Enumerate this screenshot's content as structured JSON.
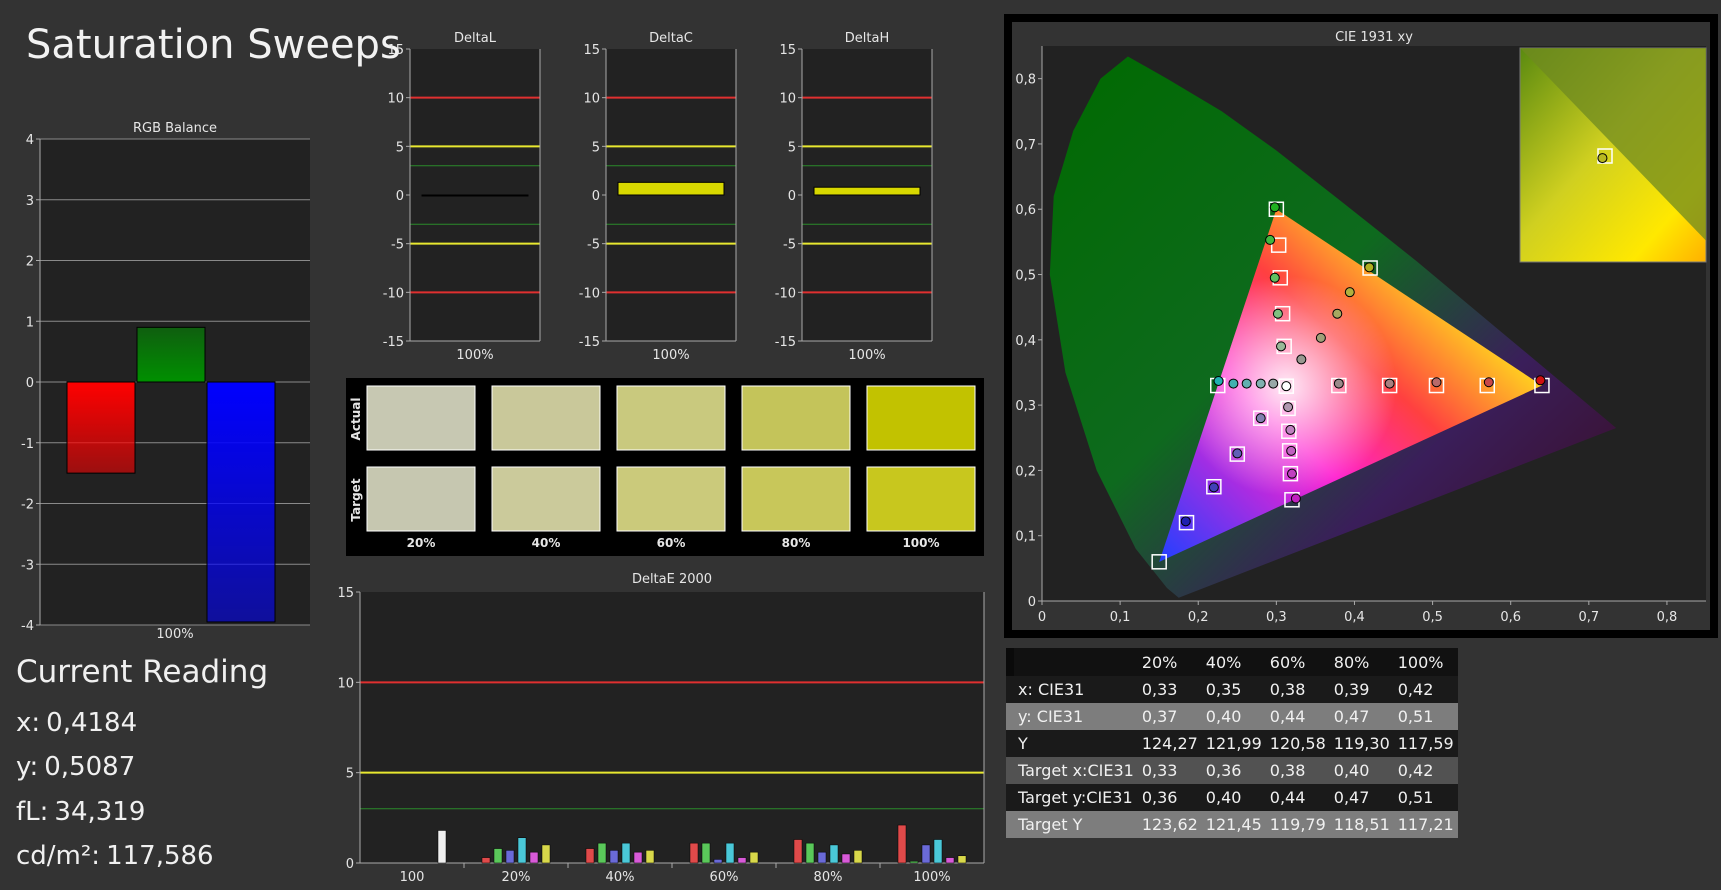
{
  "title": "Saturation Sweeps",
  "colors": {
    "background": "#333333",
    "plot_bg": "#222222",
    "red_limit": "#e03030",
    "yellow_limit": "#e8e830",
    "green_limit": "#2a8a2a",
    "bar_fill": "#d8d800"
  },
  "current_reading": {
    "title": "Current Reading",
    "x_label": "x:",
    "x_value": "0,4184",
    "y_label": "y:",
    "y_value": "0,5087",
    "fl_label": "fL:",
    "fl_value": "34,319",
    "cdm_label": "cd/m²:",
    "cdm_value": "117,586"
  },
  "swatches": {
    "row_labels": [
      "Actual",
      "Target"
    ],
    "labels": [
      "20%",
      "40%",
      "60%",
      "80%",
      "100%"
    ],
    "actual": [
      "#c7c8b2",
      "#c9c89a",
      "#c9c97e",
      "#c4c45a",
      "#c2c200"
    ],
    "target": [
      "#c6c7b0",
      "#cbca9b",
      "#cbca7b",
      "#c8c75a",
      "#c8c71e"
    ]
  },
  "table": {
    "headers": [
      "",
      "20%",
      "40%",
      "60%",
      "80%",
      "100%"
    ],
    "rows": [
      {
        "label": "x: CIE31",
        "values": [
          "0,33",
          "0,35",
          "0,38",
          "0,39",
          "0,42"
        ]
      },
      {
        "label": "y: CIE31",
        "values": [
          "0,37",
          "0,40",
          "0,44",
          "0,47",
          "0,51"
        ]
      },
      {
        "label": "Y",
        "values": [
          "124,27",
          "121,99",
          "120,58",
          "119,30",
          "117,59"
        ]
      },
      {
        "label": "Target x:CIE31",
        "values": [
          "0,33",
          "0,36",
          "0,38",
          "0,40",
          "0,42"
        ]
      },
      {
        "label": "Target y:CIE31",
        "values": [
          "0,36",
          "0,40",
          "0,44",
          "0,47",
          "0,51"
        ]
      },
      {
        "label": "Target Y",
        "values": [
          "123,62",
          "121,45",
          "119,79",
          "118,51",
          "117,21"
        ]
      }
    ]
  },
  "chart_data": [
    {
      "type": "bar",
      "title": "RGB Balance",
      "categories": [
        "100%"
      ],
      "series": [
        {
          "values": [
            -1.5
          ],
          "color": "#ff0000"
        },
        {
          "values": [
            0.9
          ],
          "color": "#009000"
        },
        {
          "values": [
            -3.95
          ],
          "color": "#0000ff"
        }
      ],
      "ylim": [
        -4,
        4
      ],
      "yticks": [
        "-4",
        "-3",
        "-2",
        "-1",
        "0",
        "1",
        "2",
        "3",
        "4"
      ],
      "grid": true
    },
    {
      "type": "bar",
      "title": "DeltaL",
      "categories": [
        "100%"
      ],
      "values": [
        0
      ],
      "ylim": [
        -15,
        15
      ],
      "yticks": [
        "-15",
        "-10",
        "-5",
        "0",
        "5",
        "10",
        "15"
      ],
      "limits": {
        "red": [
          10,
          -10
        ],
        "yellow": [
          5,
          -5
        ],
        "green": [
          3,
          -3
        ]
      }
    },
    {
      "type": "bar",
      "title": "DeltaC",
      "categories": [
        "100%"
      ],
      "values": [
        1.3
      ],
      "ylim": [
        -15,
        15
      ],
      "yticks": [
        "-15",
        "-10",
        "-5",
        "0",
        "5",
        "10",
        "15"
      ],
      "limits": {
        "red": [
          10,
          -10
        ],
        "yellow": [
          5,
          -5
        ],
        "green": [
          3,
          -3
        ]
      }
    },
    {
      "type": "bar",
      "title": "DeltaH",
      "categories": [
        "100%"
      ],
      "values": [
        0.8
      ],
      "ylim": [
        -15,
        15
      ],
      "yticks": [
        "-15",
        "-10",
        "-5",
        "0",
        "5",
        "10",
        "15"
      ],
      "limits": {
        "red": [
          10,
          -10
        ],
        "yellow": [
          5,
          -5
        ],
        "green": [
          3,
          -3
        ]
      }
    },
    {
      "type": "bar",
      "title": "DeltaE 2000",
      "categories": [
        "100",
        "20%",
        "40%",
        "60%",
        "80%",
        "100%"
      ],
      "series_colors": [
        "#e04a4a",
        "#5ac85a",
        "#6a6ad8",
        "#4ac8d8",
        "#d85ad8",
        "#d8d84a"
      ],
      "groups": [
        [
          0,
          0,
          0,
          0,
          0,
          1.8
        ],
        [
          0.3,
          0.8,
          0.7,
          1.4,
          0.6,
          1.0
        ],
        [
          0.8,
          1.1,
          0.7,
          1.1,
          0.6,
          0.7
        ],
        [
          1.1,
          1.1,
          0.2,
          1.1,
          0.3,
          0.6
        ],
        [
          1.3,
          1.1,
          0.6,
          1.0,
          0.5,
          0.7
        ],
        [
          2.1,
          0.1,
          1.0,
          1.3,
          0.3,
          0.4
        ]
      ],
      "ylim": [
        0,
        15
      ],
      "yticks": [
        "0",
        "5",
        "10",
        "15"
      ],
      "limits": {
        "red": [
          10
        ],
        "yellow": [
          5
        ],
        "green": [
          3
        ]
      }
    },
    {
      "type": "scatter",
      "title": "CIE 1931 xy",
      "xlim": [
        0,
        0.85
      ],
      "ylim": [
        0,
        0.85
      ],
      "xticks": [
        "0",
        "0,1",
        "0,2",
        "0,3",
        "0,4",
        "0,5",
        "0,6",
        "0,7",
        "0,8"
      ],
      "yticks": [
        "0",
        "0,1",
        "0,2",
        "0,3",
        "0,4",
        "0,5",
        "0,6",
        "0,7",
        "0,8"
      ],
      "gamut": {
        "red": [
          0.64,
          0.33
        ],
        "green": [
          0.3,
          0.6
        ],
        "blue": [
          0.15,
          0.06
        ],
        "white": [
          0.3127,
          0.329
        ]
      },
      "targets": [
        [
          0.64,
          0.33
        ],
        [
          0.57,
          0.33
        ],
        [
          0.505,
          0.33
        ],
        [
          0.445,
          0.33
        ],
        [
          0.38,
          0.33
        ],
        [
          0.3,
          0.6
        ],
        [
          0.303,
          0.545
        ],
        [
          0.305,
          0.495
        ],
        [
          0.308,
          0.44
        ],
        [
          0.31,
          0.39
        ],
        [
          0.15,
          0.06
        ],
        [
          0.185,
          0.12
        ],
        [
          0.22,
          0.175
        ],
        [
          0.25,
          0.225
        ],
        [
          0.28,
          0.28
        ],
        [
          0.42,
          0.51
        ],
        [
          0.3127,
          0.329
        ],
        [
          0.225,
          0.33
        ],
        [
          0.32,
          0.155
        ],
        [
          0.318,
          0.195
        ],
        [
          0.317,
          0.23
        ],
        [
          0.316,
          0.26
        ],
        [
          0.315,
          0.295
        ]
      ],
      "measured": [
        {
          "x": 0.638,
          "y": 0.338,
          "c": "#d01010"
        },
        {
          "x": 0.572,
          "y": 0.335,
          "c": "#c84848"
        },
        {
          "x": 0.505,
          "y": 0.335,
          "c": "#b86a6a"
        },
        {
          "x": 0.445,
          "y": 0.333,
          "c": "#a88080"
        },
        {
          "x": 0.38,
          "y": 0.333,
          "c": "#9a8a8a"
        },
        {
          "x": 0.298,
          "y": 0.603,
          "c": "#20b020"
        },
        {
          "x": 0.292,
          "y": 0.553,
          "c": "#40b840"
        },
        {
          "x": 0.298,
          "y": 0.495,
          "c": "#60c060"
        },
        {
          "x": 0.302,
          "y": 0.44,
          "c": "#80c080"
        },
        {
          "x": 0.306,
          "y": 0.39,
          "c": "#98b898"
        },
        {
          "x": 0.184,
          "y": 0.122,
          "c": "#2020b0"
        },
        {
          "x": 0.22,
          "y": 0.174,
          "c": "#4040b8"
        },
        {
          "x": 0.25,
          "y": 0.226,
          "c": "#6060b8"
        },
        {
          "x": 0.28,
          "y": 0.28,
          "c": "#8080b0"
        },
        {
          "x": 0.419,
          "y": 0.511,
          "c": "#b0b020"
        },
        {
          "x": 0.394,
          "y": 0.473,
          "c": "#b0b040"
        },
        {
          "x": 0.378,
          "y": 0.44,
          "c": "#a8a860"
        },
        {
          "x": 0.357,
          "y": 0.403,
          "c": "#a0a078"
        },
        {
          "x": 0.332,
          "y": 0.37,
          "c": "#989890"
        },
        {
          "x": 0.226,
          "y": 0.337,
          "c": "#20b0b0"
        },
        {
          "x": 0.245,
          "y": 0.333,
          "c": "#40b0b0"
        },
        {
          "x": 0.262,
          "y": 0.333,
          "c": "#60b0b0"
        },
        {
          "x": 0.28,
          "y": 0.333,
          "c": "#80b0b0"
        },
        {
          "x": 0.296,
          "y": 0.333,
          "c": "#98a8a8"
        },
        {
          "x": 0.3127,
          "y": 0.329,
          "c": "#ffffff"
        },
        {
          "x": 0.325,
          "y": 0.157,
          "c": "#c020c0"
        },
        {
          "x": 0.32,
          "y": 0.195,
          "c": "#c040c0"
        },
        {
          "x": 0.319,
          "y": 0.23,
          "c": "#c060c0"
        },
        {
          "x": 0.318,
          "y": 0.262,
          "c": "#c080c0"
        },
        {
          "x": 0.315,
          "y": 0.297,
          "c": "#b098b0"
        }
      ],
      "inset": {
        "target": [
          0.42,
          0.51
        ],
        "measured": [
          0.4184,
          0.5087
        ]
      }
    }
  ]
}
